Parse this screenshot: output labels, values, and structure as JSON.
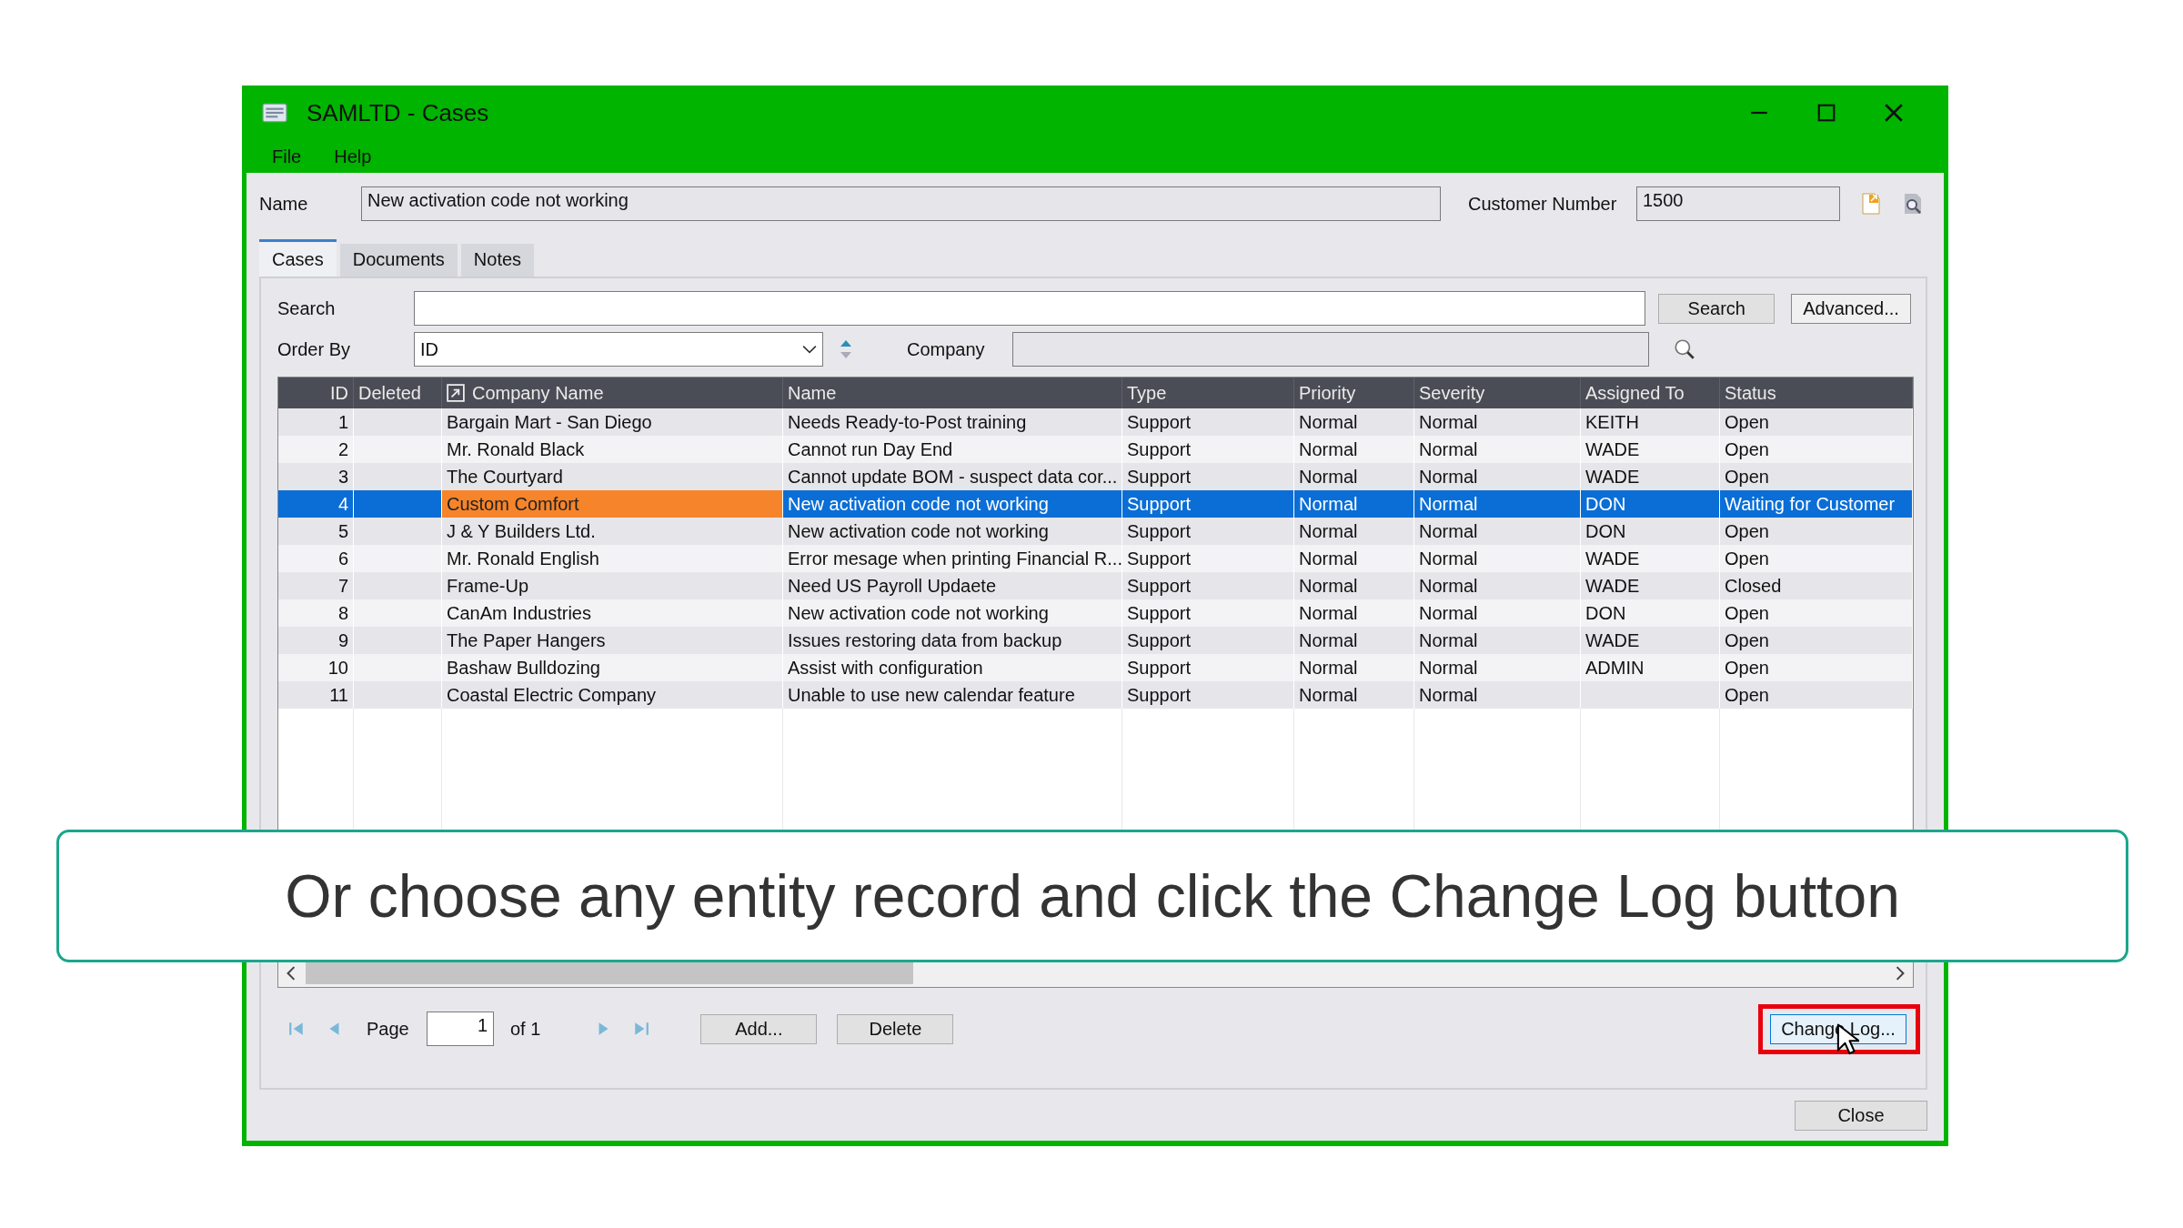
{
  "window": {
    "title": "SAMLTD - Cases"
  },
  "menu": [
    {
      "label": "File"
    },
    {
      "label": "Help"
    }
  ],
  "name_field": {
    "label": "Name",
    "value": "New activation code not working"
  },
  "customer_number": {
    "label": "Customer Number",
    "value": "1500"
  },
  "tabs": [
    {
      "label": "Cases",
      "selected": true
    },
    {
      "label": "Documents",
      "selected": false
    },
    {
      "label": "Notes",
      "selected": false
    }
  ],
  "search": {
    "label": "Search",
    "button": "Search",
    "advanced_button": "Advanced..."
  },
  "order_by": {
    "label": "Order By",
    "value": "ID"
  },
  "company": {
    "label": "Company"
  },
  "table": {
    "columns": [
      {
        "label": "ID",
        "kind": "number",
        "current": false
      },
      {
        "label": "Deleted",
        "kind": "text",
        "current": false
      },
      {
        "label": "Company Name",
        "kind": "linked",
        "current": true
      },
      {
        "label": "Name",
        "kind": "text",
        "current": false
      },
      {
        "label": "Type",
        "kind": "text",
        "current": false
      },
      {
        "label": "Priority",
        "kind": "text",
        "current": false
      },
      {
        "label": "Severity",
        "kind": "text",
        "current": false
      },
      {
        "label": "Assigned To",
        "kind": "text",
        "current": false
      },
      {
        "label": "Status",
        "kind": "text",
        "current": false
      }
    ],
    "rows": [
      {
        "selected": false,
        "cells": [
          "1",
          null,
          "Bargain Mart - San Diego",
          "Needs Ready-to-Post training",
          "Support",
          "Normal",
          "Normal",
          "KEITH",
          "Open"
        ]
      },
      {
        "selected": false,
        "cells": [
          "2",
          null,
          "Mr. Ronald Black",
          "Cannot run Day End",
          "Support",
          "Normal",
          "Normal",
          "WADE",
          "Open"
        ]
      },
      {
        "selected": false,
        "cells": [
          "3",
          null,
          "The Courtyard",
          "Cannot update BOM - suspect data cor...",
          "Support",
          "Normal",
          "Normal",
          "WADE",
          "Open"
        ]
      },
      {
        "selected": true,
        "cells": [
          "4",
          null,
          "Custom Comfort",
          "New activation code not working",
          "Support",
          "Normal",
          "Normal",
          "DON",
          "Waiting for Customer"
        ]
      },
      {
        "selected": false,
        "cells": [
          "5",
          null,
          "J & Y Builders Ltd.",
          "New activation code not working",
          "Support",
          "Normal",
          "Normal",
          "DON",
          "Open"
        ]
      },
      {
        "selected": false,
        "cells": [
          "6",
          null,
          "Mr. Ronald English",
          "Error mesage when printing Financial R...",
          "Support",
          "Normal",
          "Normal",
          "WADE",
          "Open"
        ]
      },
      {
        "selected": false,
        "cells": [
          "7",
          null,
          "Frame-Up",
          "Need US Payroll Updaete",
          "Support",
          "Normal",
          "Normal",
          "WADE",
          "Closed"
        ]
      },
      {
        "selected": false,
        "cells": [
          "8",
          null,
          "CanAm Industries",
          "New activation code not working",
          "Support",
          "Normal",
          "Normal",
          "DON",
          "Open"
        ]
      },
      {
        "selected": false,
        "cells": [
          "9",
          null,
          "The Paper Hangers",
          "Issues restoring data from backup",
          "Support",
          "Normal",
          "Normal",
          "WADE",
          "Open"
        ]
      },
      {
        "selected": false,
        "cells": [
          "10",
          null,
          "Bashaw Bulldozing",
          "Assist with configuration",
          "Support",
          "Normal",
          "Normal",
          "ADMIN",
          "Open"
        ]
      },
      {
        "selected": false,
        "cells": [
          "11",
          null,
          "Coastal Electric Company",
          "Unable to use new calendar feature",
          "Support",
          "Normal",
          "Normal",
          null,
          "Open"
        ]
      }
    ]
  },
  "pager": {
    "label": "Page",
    "value": "1",
    "total": "of 1"
  },
  "buttons": {
    "add": "Add...",
    "delete": "Delete",
    "change_log": "Change Log...",
    "close": "Close"
  },
  "caption": "Or choose any entity record and click the Change Log button"
}
